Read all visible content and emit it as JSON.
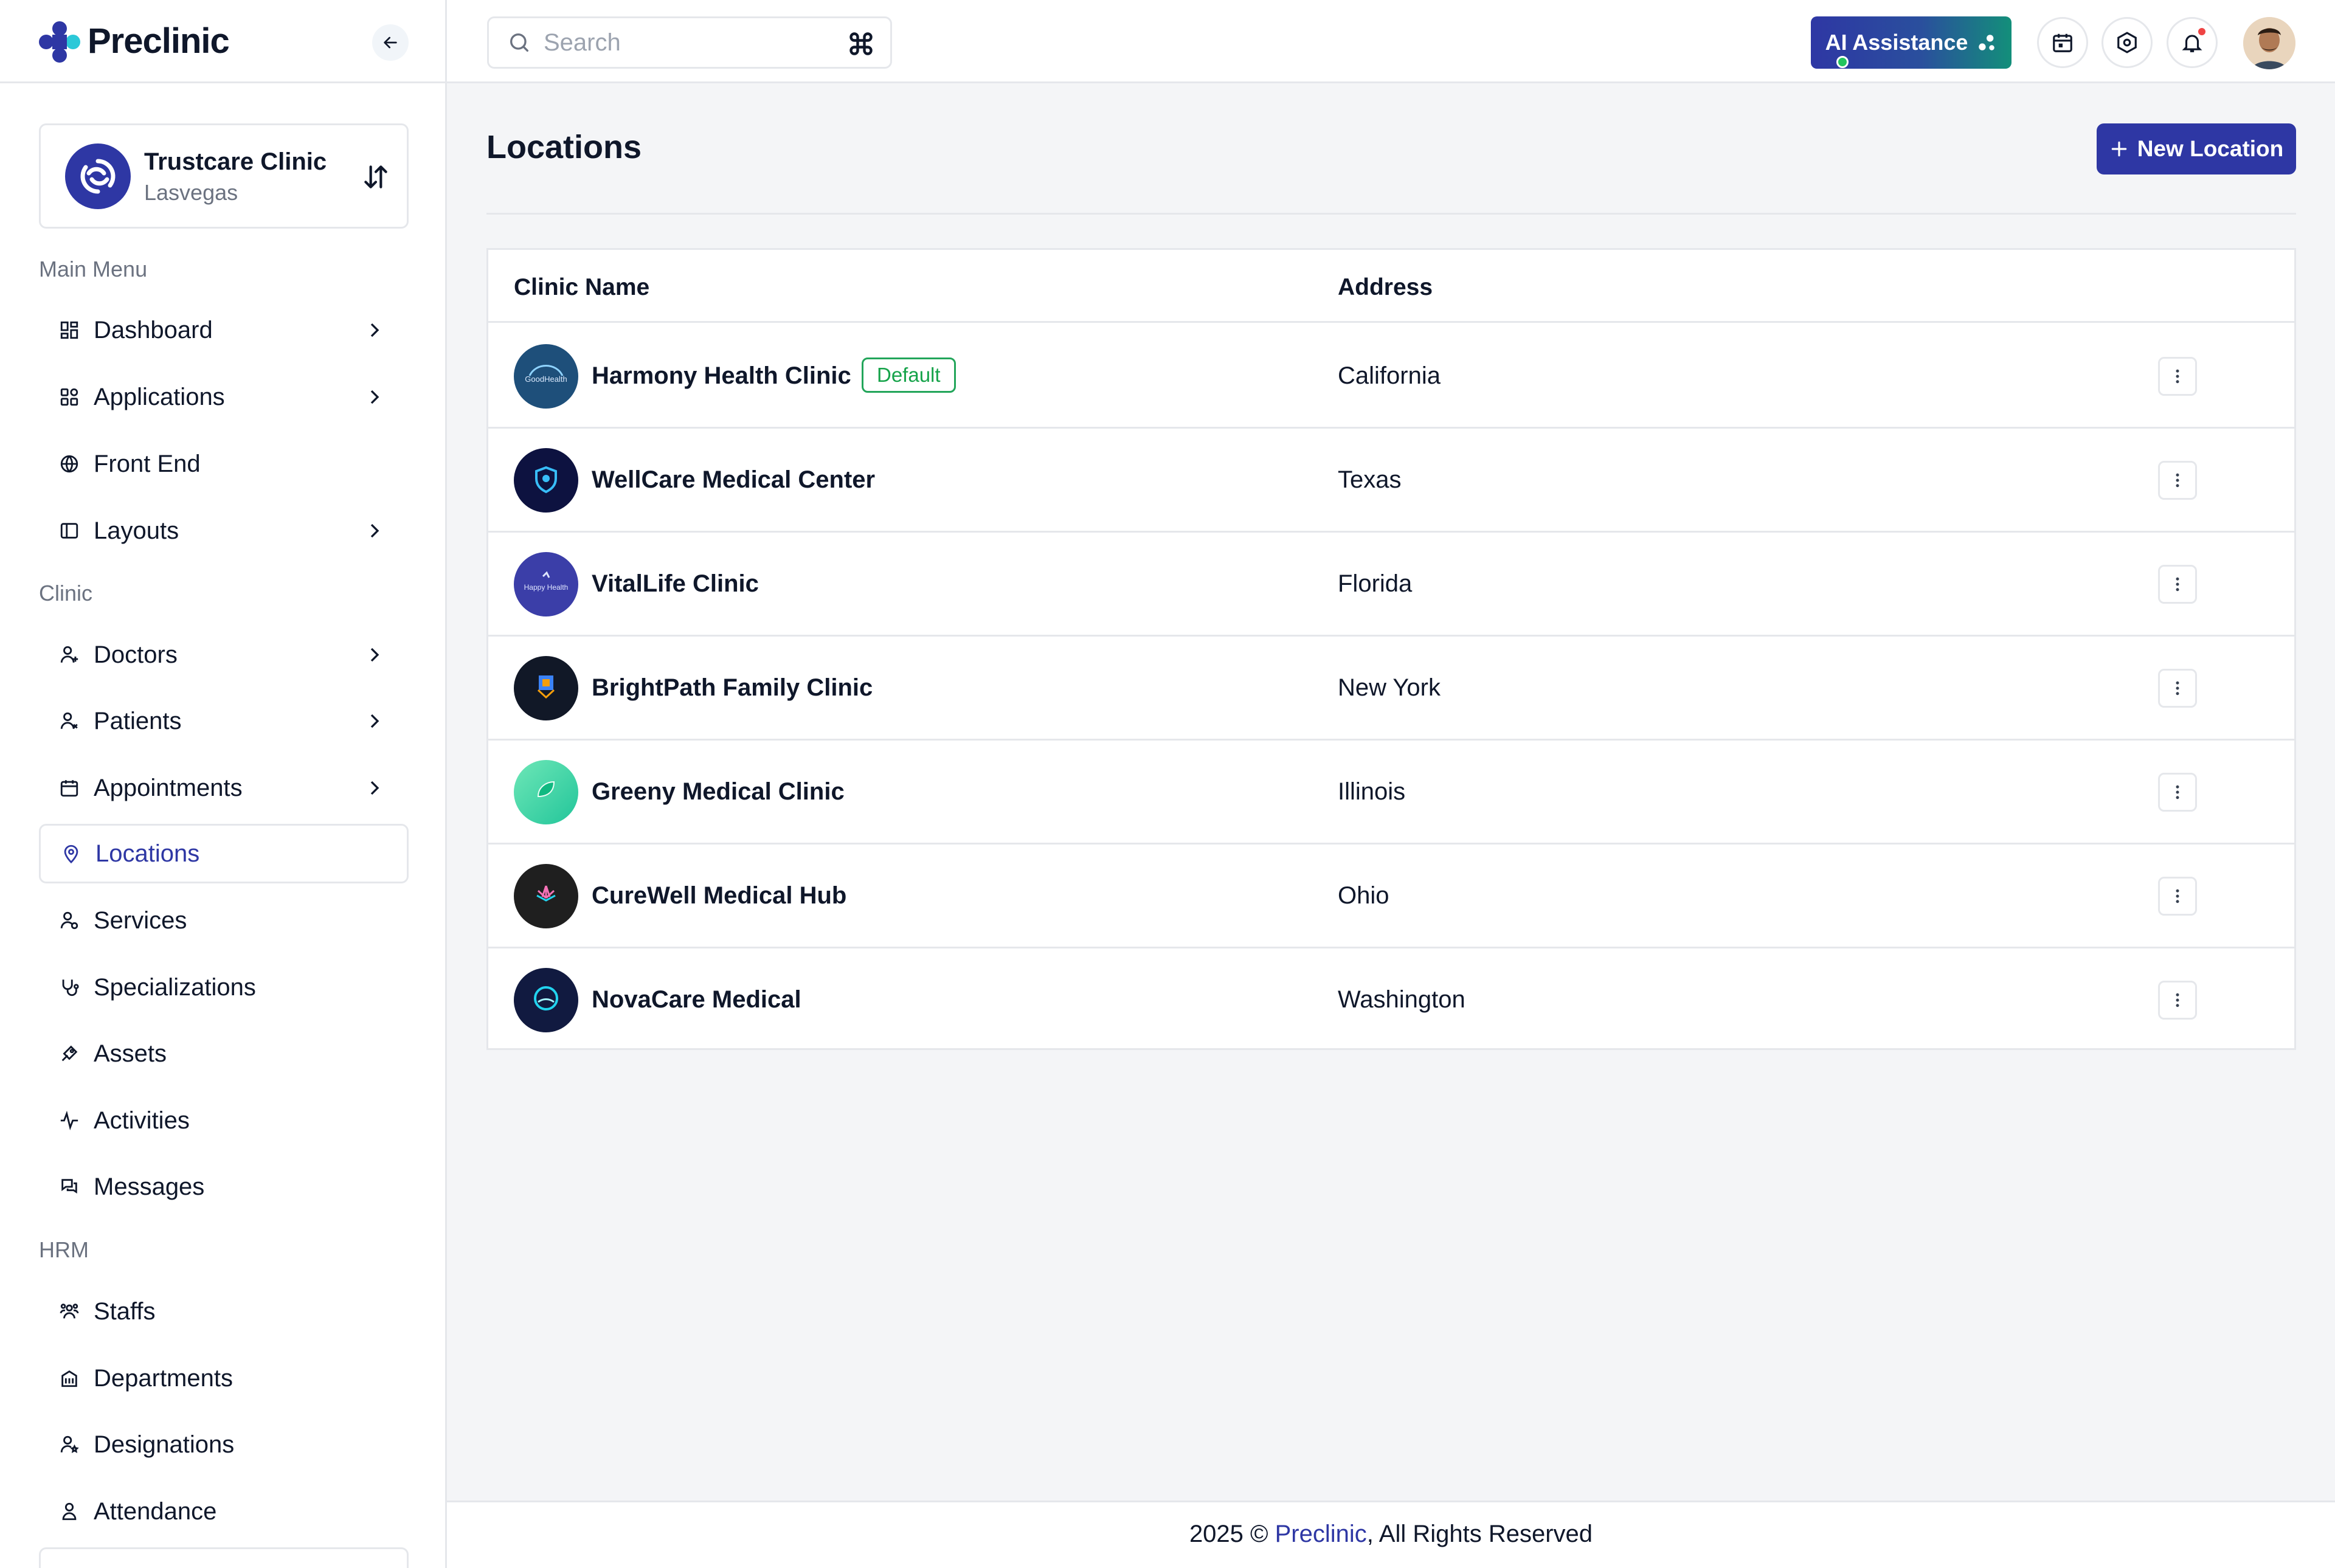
{
  "brand": {
    "name": "Preclinic"
  },
  "clinic": {
    "name": "Trustcare Clinic",
    "city": "Lasvegas"
  },
  "search": {
    "placeholder": "Search"
  },
  "topbar": {
    "ai_label": "AI Assistance"
  },
  "sidebar": {
    "main_heading": "Main Menu",
    "clinic_heading": "Clinic",
    "hrm_heading": "HRM",
    "main_items": [
      {
        "label": "Dashboard",
        "icon": "dashboard-icon"
      },
      {
        "label": "Applications",
        "icon": "apps-icon"
      },
      {
        "label": "Front End",
        "icon": "globe-icon"
      },
      {
        "label": "Layouts",
        "icon": "layout-icon"
      }
    ],
    "clinic_items": [
      {
        "label": "Doctors",
        "icon": "doctor-icon"
      },
      {
        "label": "Patients",
        "icon": "patient-icon"
      },
      {
        "label": "Appointments",
        "icon": "calendar-icon"
      },
      {
        "label": "Locations",
        "icon": "location-pin-icon",
        "active": true
      },
      {
        "label": "Services",
        "icon": "services-icon"
      },
      {
        "label": "Specializations",
        "icon": "stethoscope-icon"
      },
      {
        "label": "Assets",
        "icon": "assets-icon"
      },
      {
        "label": "Activities",
        "icon": "activity-icon"
      },
      {
        "label": "Messages",
        "icon": "messages-icon"
      }
    ],
    "hrm_items": [
      {
        "label": "Staffs",
        "icon": "staffs-icon"
      },
      {
        "label": "Departments",
        "icon": "building-icon"
      },
      {
        "label": "Designations",
        "icon": "designation-icon"
      },
      {
        "label": "Attendance",
        "icon": "attendance-icon"
      }
    ]
  },
  "page": {
    "title": "Locations",
    "new_button": "New Location"
  },
  "table": {
    "headers": {
      "name": "Clinic Name",
      "address": "Address"
    },
    "default_badge": "Default",
    "rows": [
      {
        "name": "Harmony Health Clinic",
        "address": "California",
        "default": true,
        "logo_color": "#1e4f7a"
      },
      {
        "name": "WellCare Medical Center",
        "address": "Texas",
        "logo_color": "#0d1240"
      },
      {
        "name": "VitalLife Clinic",
        "address": "Florida",
        "logo_color": "#3b3ea8"
      },
      {
        "name": "BrightPath Family Clinic",
        "address": "New York",
        "logo_color": "#111827"
      },
      {
        "name": "Greeny Medical Clinic",
        "address": "Illinois",
        "logo_color": "#3ed49a"
      },
      {
        "name": "CureWell Medical Hub",
        "address": "Ohio",
        "logo_color": "#1f1f1f"
      },
      {
        "name": "NovaCare Medical",
        "address": "Washington",
        "logo_color": "#111a40"
      }
    ]
  },
  "footer": {
    "prefix": "2025 © ",
    "brand": "Preclinic",
    "suffix": ", All Rights Reserved"
  },
  "colors": {
    "primary": "#2e37a4",
    "success": "#16a34a",
    "border": "#e5e7eb"
  }
}
